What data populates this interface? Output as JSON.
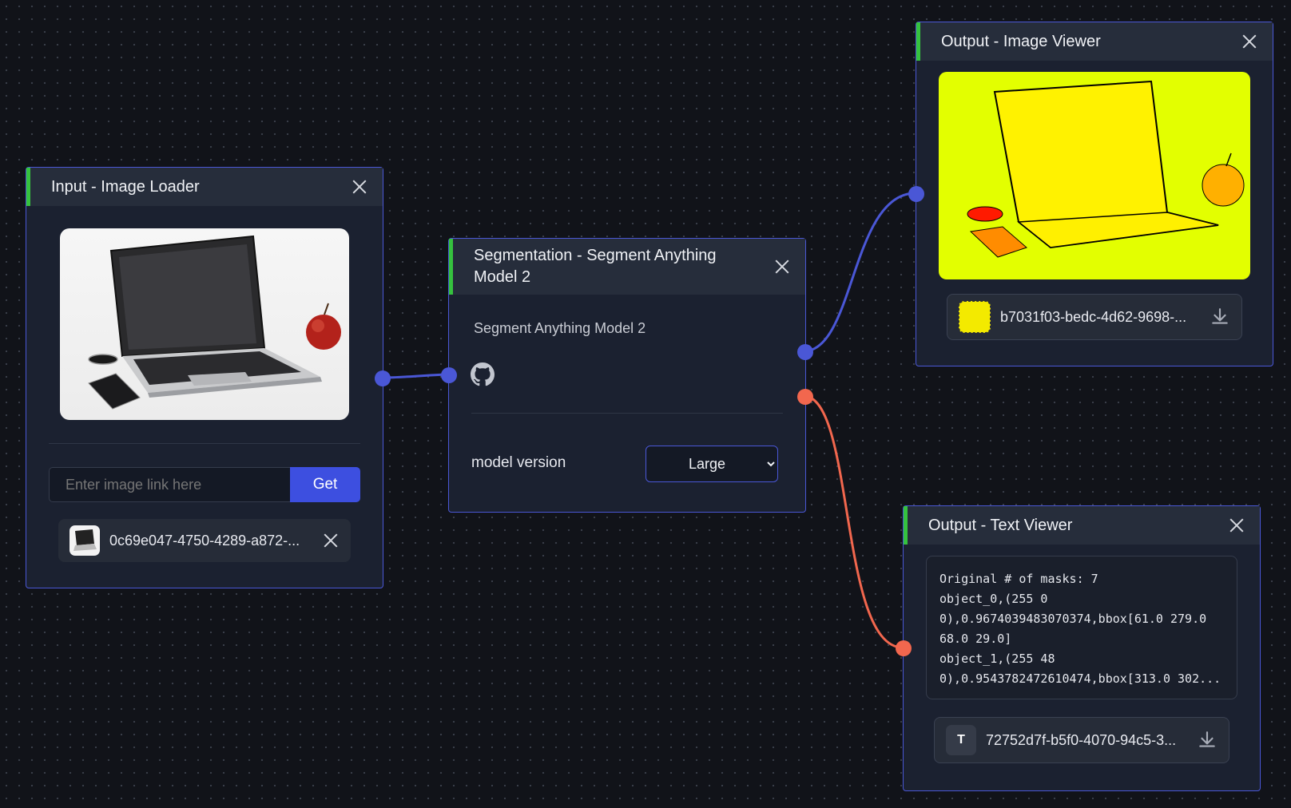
{
  "nodes": {
    "image_loader": {
      "title": "Input - Image Loader",
      "link_placeholder": "Enter image link here",
      "get_label": "Get",
      "file_name": "0c69e047-4750-4289-a872-..."
    },
    "segmentation": {
      "title": "Segmentation - Segment Anything Model 2",
      "description": "Segment Anything Model 2",
      "param_label": "model version",
      "model_options": [
        "Large"
      ],
      "model_selected": "Large"
    },
    "image_viewer": {
      "title": "Output - Image Viewer",
      "file_name": "b7031f03-bedc-4d62-9698-..."
    },
    "text_viewer": {
      "title": "Output - Text Viewer",
      "text_lines": [
        "Original # of masks: 7",
        "object_0,(255 0",
        "0),0.9674039483070374,bbox[61.0 279.0",
        "68.0 29.0]",
        "object_1,(255 48",
        "0),0.9543782472610474,bbox[313.0 302..."
      ],
      "file_badge": "T",
      "file_name": "72752d7f-b5f0-4070-94c5-3..."
    }
  },
  "colors": {
    "background": "#111319",
    "node_border": "#4a57d6",
    "header_accent": "#35c23e",
    "wire_blue": "#4a57d6",
    "wire_red": "#f2674e",
    "button_blue": "#3d4fe0"
  },
  "icons": [
    "close-icon",
    "github-icon",
    "download-icon"
  ]
}
